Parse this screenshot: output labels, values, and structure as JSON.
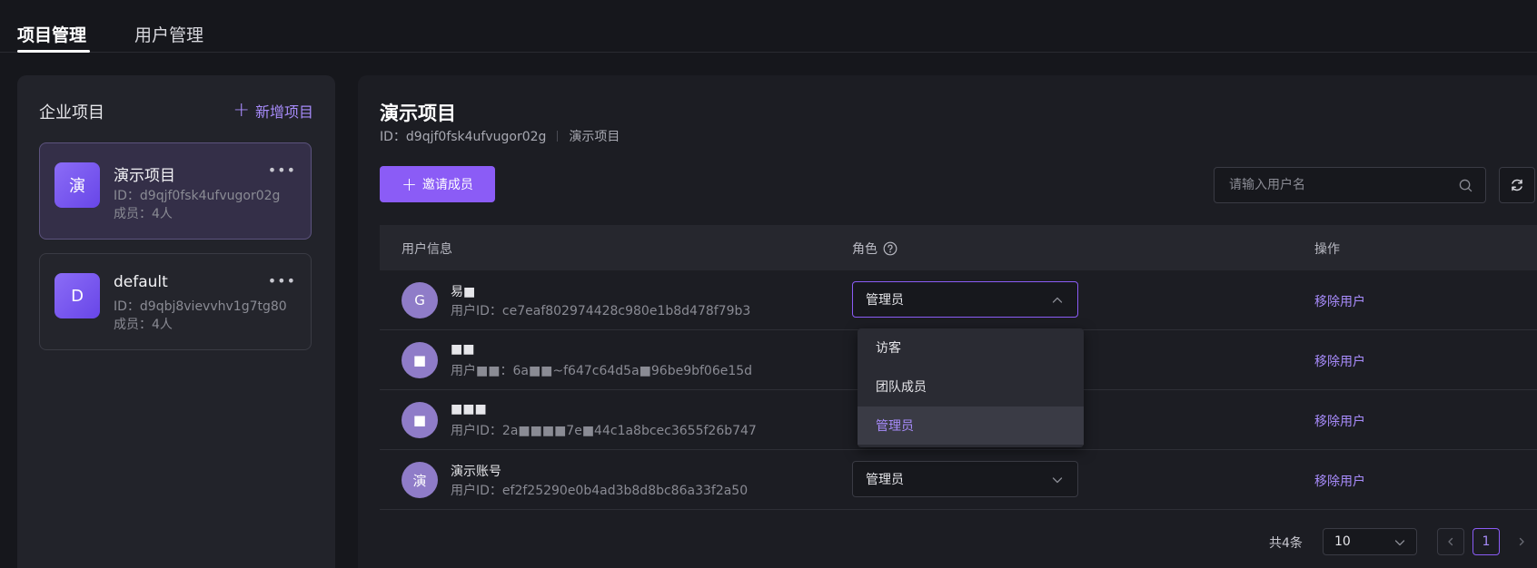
{
  "top_tabs": [
    {
      "label": "项目管理",
      "active": true
    },
    {
      "label": "用户管理",
      "active": false
    }
  ],
  "sidebar": {
    "title": "企业项目",
    "add_label": "新增项目",
    "projects": [
      {
        "avatar": "演",
        "name": "演示项目",
        "id_text": "ID：d9qjf0fsk4ufvugor02g",
        "members_text": "成员：4人",
        "selected": true
      },
      {
        "avatar": "D",
        "name": "default",
        "id_text": "ID：d9qbj8vievvhv1g7tg80",
        "members_text": "成员：4人",
        "selected": false
      }
    ]
  },
  "main": {
    "title": "演示项目",
    "id_text": "ID：d9qjf0fsk4ufvugor02g",
    "subtitle_name": "演示项目",
    "invite_label": "邀请成员",
    "search_placeholder": "请输入用户名"
  },
  "table": {
    "headers": {
      "user": "用户信息",
      "role": "角色",
      "action": "操作"
    },
    "rows": [
      {
        "avatar": "G",
        "name": "易■",
        "uid": "用户ID：ce7eaf802974428c980e1b8d478f79b3",
        "role": "管理员",
        "role_open": true,
        "action": "移除用户"
      },
      {
        "avatar": "■",
        "name": "■■",
        "uid": "用户■■：6a■■~f647c64d5a■96be9bf06e15d",
        "role": "",
        "role_open": false,
        "action": "移除用户"
      },
      {
        "avatar": "■",
        "name": "■■■",
        "uid": "用户ID：2a■■■■7e■44c1a8bcec3655f26b747",
        "role": "",
        "role_open": false,
        "action": "移除用户"
      },
      {
        "avatar": "演",
        "name": "演示账号",
        "uid": "用户ID：ef2f25290e0b4ad3b8d8bc86a33f2a50",
        "role": "管理员",
        "role_open": false,
        "action": "移除用户"
      }
    ]
  },
  "role_dropdown": {
    "options": [
      "访客",
      "团队成员",
      "管理员"
    ],
    "selected": "管理员"
  },
  "pagination": {
    "total_text": "共4条",
    "page_size": "10",
    "current_page": "1"
  },
  "colors": {
    "accent": "#8b5cf6",
    "accent_text": "#a78bfa",
    "background": "#16171c",
    "panel": "#1c1d23"
  }
}
